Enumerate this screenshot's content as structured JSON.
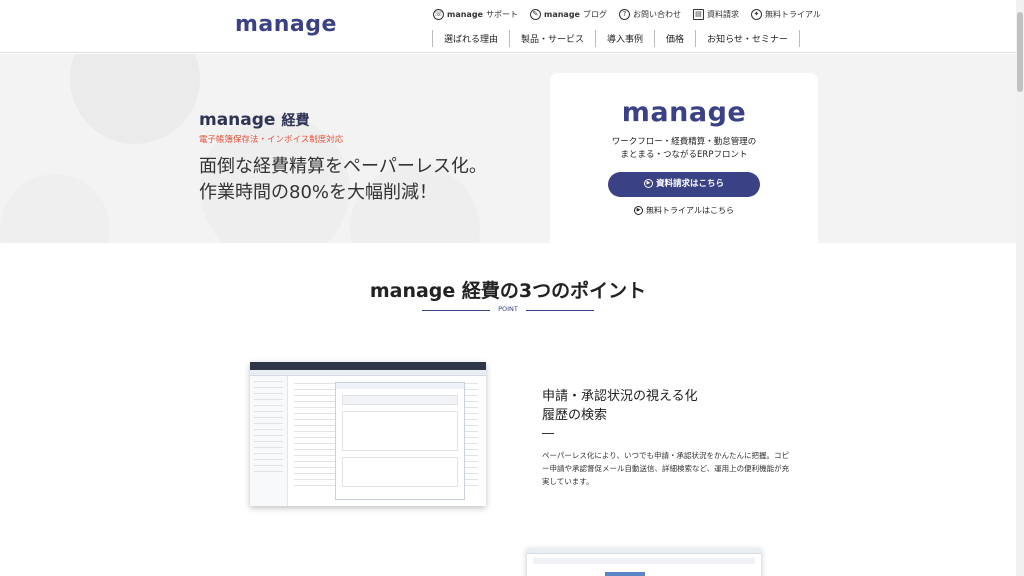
{
  "header": {
    "logo": "manage",
    "util_nav": [
      {
        "icon": "support-icon",
        "bold": "manage",
        "label": "サポート"
      },
      {
        "icon": "blog-icon",
        "bold": "manage",
        "label": "ブログ"
      },
      {
        "icon": "question-icon",
        "bold": "",
        "label": "お問い合わせ"
      },
      {
        "icon": "document-icon",
        "bold": "",
        "label": "資料請求"
      },
      {
        "icon": "trial-icon",
        "bold": "",
        "label": "無料トライアル"
      }
    ],
    "main_nav": [
      "選ばれる理由",
      "製品・サービス",
      "導入事例",
      "価格",
      "お知らせ・セミナー"
    ]
  },
  "hero": {
    "brand": "manage",
    "brand_suffix": "経費",
    "sub": "電子帳簿保存法・インボイス制度対応",
    "copy_line1": "面倒な経費精算をペーパーレス化。",
    "copy_line2": "作業時間の80%を大幅削減！",
    "card": {
      "logo": "manage",
      "desc_line1": "ワークフロー・経費精算・勤怠管理の",
      "desc_line2": "まとまる・つながるERPフロント",
      "button": "資料請求はこちら",
      "link": "無料トライアルはこちら"
    }
  },
  "section": {
    "title": "manage 経費の3つのポイント",
    "sub": "POINT"
  },
  "feature1": {
    "title_line1": "申請・承認状況の視える化",
    "title_line2": "履歴の検索",
    "body": "ペーパーレス化により、いつでも申請・承認状況をかんたんに把握。コピー申請や承認督促メール自動送信、詳細検索など、運用上の便利機能が充実しています。"
  },
  "colors": {
    "brand": "#3b4185",
    "accent": "#e8523a",
    "hero_bg": "#f3f3f3"
  }
}
